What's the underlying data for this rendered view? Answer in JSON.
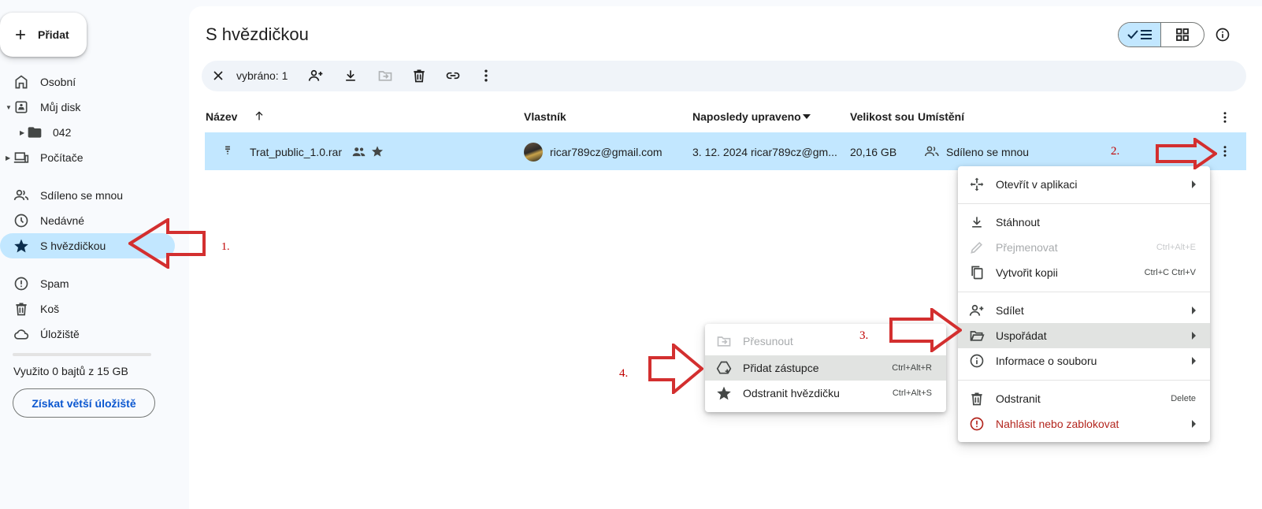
{
  "sidebar": {
    "new_label": "Přidat",
    "items": [
      {
        "label": "Osobní"
      },
      {
        "label": "Můj disk"
      },
      {
        "label": "042"
      },
      {
        "label": "Počítače"
      },
      {
        "label": "Sdíleno se mnou"
      },
      {
        "label": "Nedávné"
      },
      {
        "label": "S hvězdičkou"
      },
      {
        "label": "Spam"
      },
      {
        "label": "Koš"
      },
      {
        "label": "Úložiště"
      }
    ],
    "storage_text": "Využito 0 bajtů z 15 GB",
    "storage_button": "Získat větší úložiště"
  },
  "header": {
    "title": "S hvězdičkou"
  },
  "selection_bar": {
    "count_label": "vybráno: 1"
  },
  "table": {
    "columns": [
      "Název",
      "Vlastník",
      "Naposledy upraveno",
      "Velikost soub",
      "Umístění"
    ],
    "rows": [
      {
        "name": "Trat_public_1.0.rar",
        "owner": "ricar789cz@gmail.com",
        "modified": "3. 12. 2024 ricar789cz@gm...",
        "size": "20,16 GB",
        "location": "Sdíleno se mnou"
      }
    ]
  },
  "context_menu": {
    "items": [
      {
        "label": "Otevřít v aplikaci",
        "shortcut": ""
      },
      {
        "label": "Stáhnout",
        "shortcut": ""
      },
      {
        "label": "Přejmenovat",
        "shortcut": "Ctrl+Alt+E"
      },
      {
        "label": "Vytvořit kopii",
        "shortcut": "Ctrl+C Ctrl+V"
      },
      {
        "label": "Sdílet",
        "shortcut": ""
      },
      {
        "label": "Uspořádat",
        "shortcut": ""
      },
      {
        "label": "Informace o souboru",
        "shortcut": ""
      },
      {
        "label": "Odstranit",
        "shortcut": "Delete"
      },
      {
        "label": "Nahlásit nebo zablokovat",
        "shortcut": ""
      }
    ]
  },
  "submenu": {
    "items": [
      {
        "label": "Přesunout",
        "shortcut": ""
      },
      {
        "label": "Přidat zástupce",
        "shortcut": "Ctrl+Alt+R"
      },
      {
        "label": "Odstranit hvězdičku",
        "shortcut": "Ctrl+Alt+S"
      }
    ]
  },
  "annotations": [
    "1.",
    "2.",
    "3.",
    "4."
  ],
  "colors": {
    "accent": "#c2e7ff",
    "link": "#0b57d0",
    "annotation": "#d32f2f",
    "danger": "#b3261e"
  }
}
